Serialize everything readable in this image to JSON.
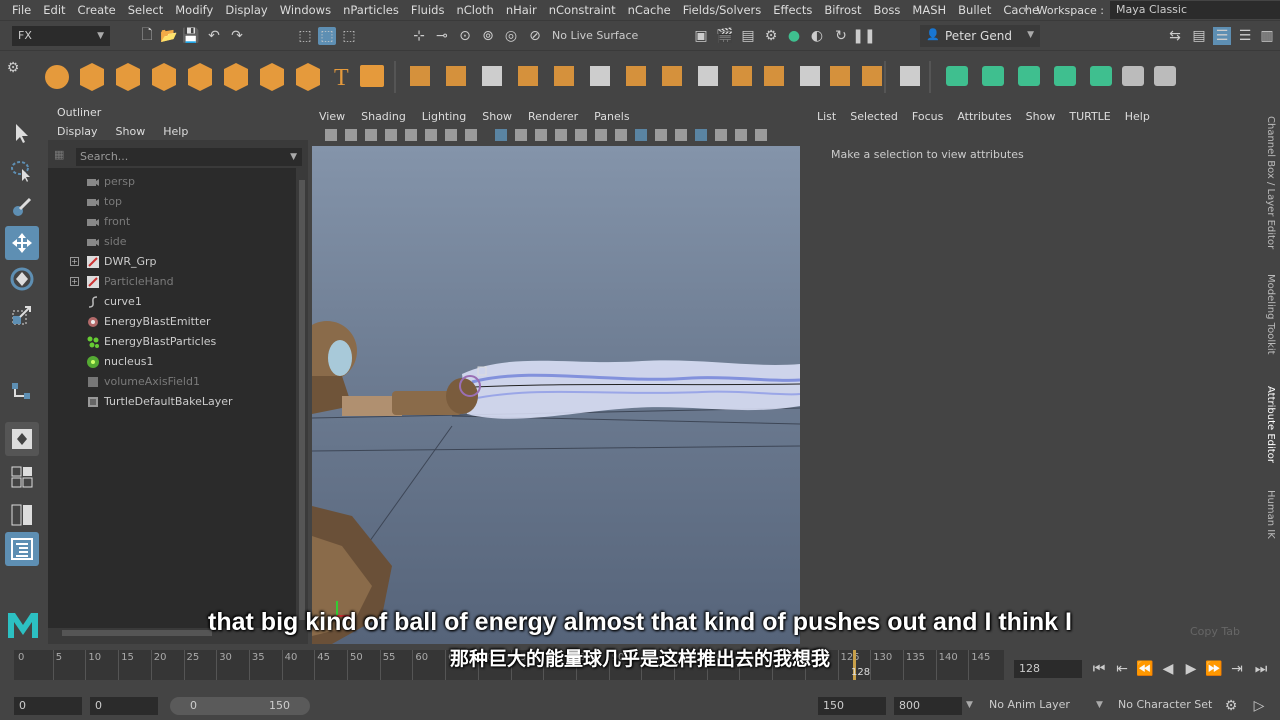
{
  "menubar": {
    "items": [
      "File",
      "Edit",
      "Create",
      "Select",
      "Modify",
      "Display",
      "Windows",
      "nParticles",
      "Fluids",
      "nCloth",
      "nHair",
      "nConstraint",
      "nCache",
      "Fields/Solvers",
      "Effects",
      "Bifrost",
      "Boss",
      "MASH",
      "Bullet",
      "Cache"
    ],
    "workspace_label": "Workspace :",
    "workspace_value": "Maya Classic"
  },
  "statusline": {
    "menuset": "FX",
    "live_surface": "No Live Surface",
    "user": "Peter Gend"
  },
  "outliner": {
    "title": "Outliner",
    "menu": [
      "Display",
      "Show",
      "Help"
    ],
    "search_placeholder": "Search...",
    "items": [
      {
        "label": "persp",
        "icon": "camera-icon"
      },
      {
        "label": "top",
        "icon": "camera-icon"
      },
      {
        "label": "front",
        "icon": "camera-icon"
      },
      {
        "label": "side",
        "icon": "camera-icon"
      },
      {
        "label": "DWR_Grp",
        "icon": "group-icon"
      },
      {
        "label": "ParticleHand",
        "icon": "group-icon"
      },
      {
        "label": "curve1",
        "icon": "curve-icon"
      },
      {
        "label": "EnergyBlastEmitter",
        "icon": "emitter-icon"
      },
      {
        "label": "EnergyBlastParticles",
        "icon": "particles-icon"
      },
      {
        "label": "nucleus1",
        "icon": "nucleus-icon"
      },
      {
        "label": "volumeAxisField1",
        "icon": "field-icon"
      },
      {
        "label": "TurtleDefaultBakeLayer",
        "icon": "layer-icon"
      }
    ]
  },
  "viewport": {
    "menu": [
      "View",
      "Shading",
      "Lighting",
      "Show",
      "Renderer",
      "Panels"
    ]
  },
  "attribute_editor": {
    "menu": [
      "List",
      "Selected",
      "Focus",
      "Attributes",
      "Show",
      "TURTLE",
      "Help"
    ],
    "message": "Make a selection to view attributes",
    "copy_tab": "Copy Tab"
  },
  "side_tabs": [
    "Channel Box / Layer Editor",
    "Modeling Toolkit",
    "Attribute Editor",
    "Human IK"
  ],
  "timeline": {
    "ticks": [
      "5",
      "10",
      "15",
      "20",
      "25",
      "30",
      "35",
      "40",
      "45",
      "50",
      "55",
      "60",
      "65",
      "70",
      "75",
      "80",
      "85",
      "90",
      "95",
      "100",
      "105",
      "110",
      "115",
      "120",
      "125",
      "130",
      "135",
      "140",
      "145"
    ],
    "current_marker": "128",
    "current_frame": "128"
  },
  "range": {
    "start": "0",
    "anim_start": "0",
    "slider_start": "0",
    "slider_end": "150",
    "anim_end": "150",
    "end": "800",
    "anim_layer": "No Anim Layer",
    "character_set": "No Character Set"
  },
  "subtitles": {
    "en": "that big kind of ball of energy almost that kind of pushes out and I think I",
    "zh": "那种巨大的能量球几乎是这样推出去的我想我"
  },
  "colors": {
    "accent_blue": "#5e8fb3",
    "poly_orange": "#e59a3c",
    "fx_green": "#3fbf8f"
  }
}
